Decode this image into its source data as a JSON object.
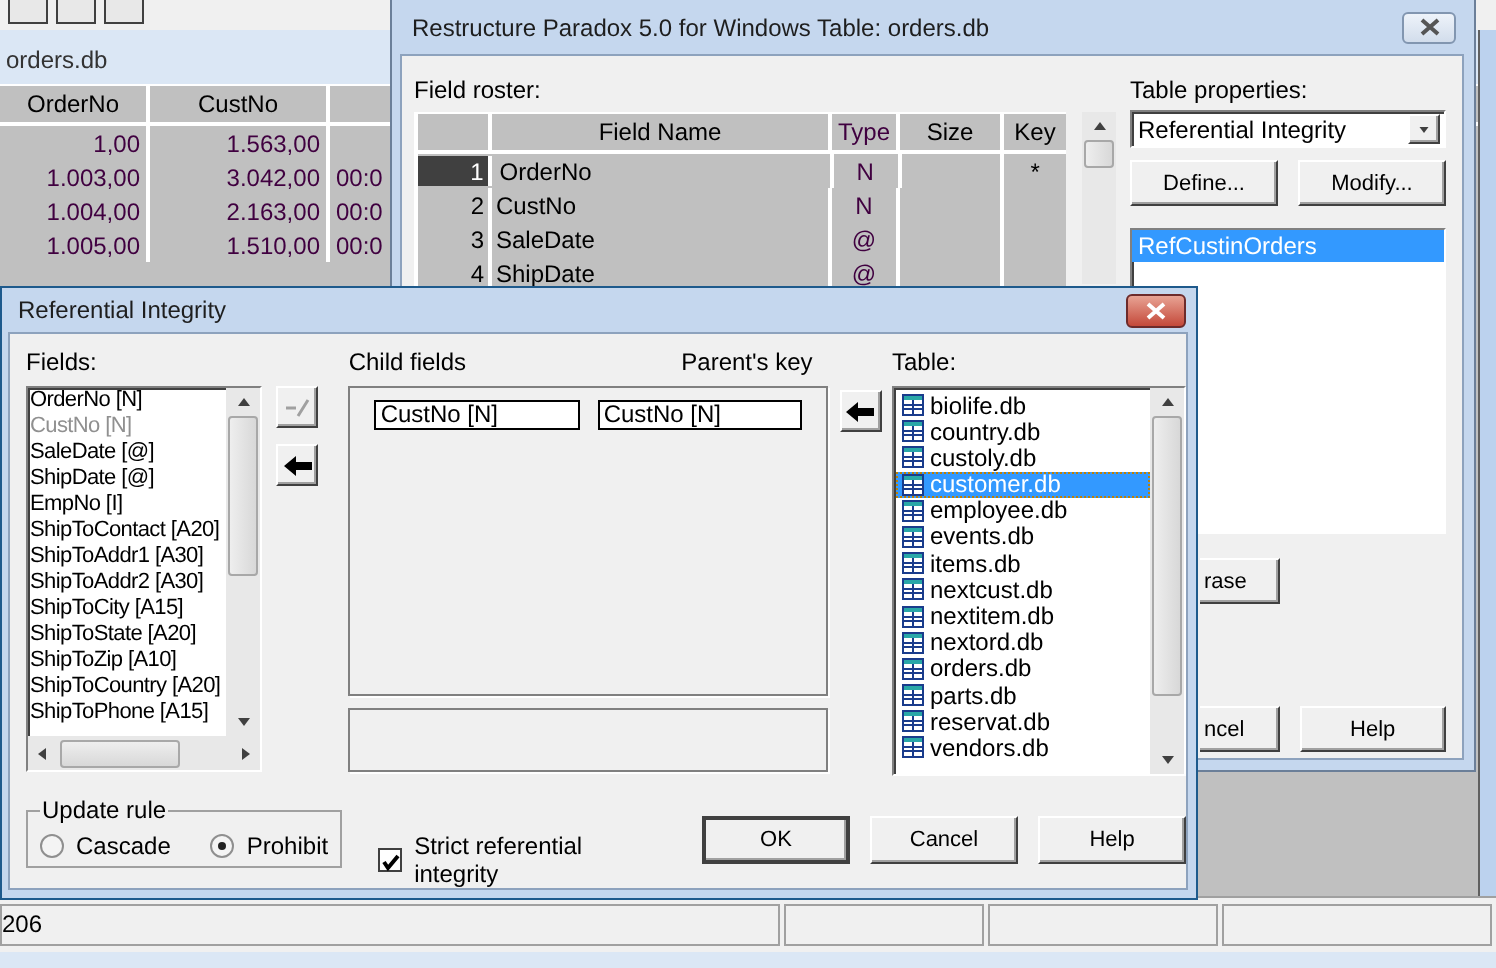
{
  "main_window": {
    "title": "orders.db",
    "columns": [
      "OrderNo",
      "CustNo"
    ],
    "rows": [
      {
        "order_no": "1,00",
        "cust_no": "1.563,00"
      },
      {
        "order_no": "1.003,00",
        "cust_no": "3.042,00",
        "column_3": "00:0"
      },
      {
        "order_no": "1.004,00",
        "cust_no": "2.163,00",
        "column_3": "00:0"
      },
      {
        "order_no": "1.005,00",
        "cust_no": "1.510,00",
        "column_3": "00:0"
      }
    ],
    "status_bar": [
      "206"
    ]
  },
  "restructure_window": {
    "title": "Restructure Paradox 5.0 for Windows Table: orders.db",
    "field_roster_label": "Field roster:",
    "roster_columns": [
      "Field Name",
      "Type",
      "Size",
      "Key"
    ],
    "fields": [
      {
        "number": "1",
        "name": "OrderNo",
        "type": "N",
        "key": "*",
        "selected": true
      },
      {
        "number": "2",
        "name": "CustNo",
        "type": "N",
        "selected": false
      },
      {
        "number": "3",
        "name": "SaleDate",
        "type": "@",
        "selected": false
      },
      {
        "number": "4",
        "name": "ShipDate",
        "type": "@",
        "selected": false
      }
    ],
    "table_properties_label": "Table properties:",
    "property_select": "Referential Integrity",
    "buttons": [
      "Define...",
      "Modify..."
    ],
    "properties": [
      {
        "label": "RefCustinOrders",
        "selected": true
      }
    ],
    "erase_button": "rase",
    "cancel_button": "ncel",
    "help_button": "Help"
  },
  "ri_dialog": {
    "title": "Referential Integrity",
    "fields_label": "Fields:",
    "fields": [
      {
        "label": "OrderNo [N]",
        "disabled": false
      },
      {
        "label": "CustNo [N]",
        "disabled": true
      },
      {
        "label": "SaleDate [@]",
        "disabled": false
      },
      {
        "label": "ShipDate [@]",
        "disabled": false
      },
      {
        "label": "EmpNo [I]",
        "disabled": false
      },
      {
        "label": "ShipToContact [A20]",
        "disabled": false
      },
      {
        "label": "ShipToAddr1 [A30]",
        "disabled": false
      },
      {
        "label": "ShipToAddr2 [A30]",
        "disabled": false
      },
      {
        "label": "ShipToCity [A15]",
        "disabled": false
      },
      {
        "label": "ShipToState [A20]",
        "disabled": false
      },
      {
        "label": "ShipToZip [A10]",
        "disabled": false
      },
      {
        "label": "ShipToCountry [A20]",
        "disabled": false
      },
      {
        "label": "ShipToPhone [A15]",
        "disabled": false
      }
    ],
    "side_buttons": [
      {
        "kind": "remove",
        "disabled": true
      },
      {
        "kind": "add",
        "disabled": false
      }
    ],
    "child_fields_label": "Child fields",
    "parents_key_label": "Parent's key",
    "child_field": "CustNo [N]",
    "parent_key": "CustNo [N]",
    "table_label": "Table:",
    "tables": [
      {
        "label": "biolife.db",
        "selected": false
      },
      {
        "label": "country.db",
        "selected": false
      },
      {
        "label": "custoly.db",
        "selected": false
      },
      {
        "label": "customer.db",
        "selected": true
      },
      {
        "label": "employee.db",
        "selected": false
      },
      {
        "label": "events.db",
        "selected": false
      },
      {
        "label": "items.db",
        "selected": false
      },
      {
        "label": "nextcust.db",
        "selected": false
      },
      {
        "label": "nextitem.db",
        "selected": false
      },
      {
        "label": "nextord.db",
        "selected": false
      },
      {
        "label": "orders.db",
        "selected": false
      },
      {
        "label": "parts.db",
        "selected": false
      },
      {
        "label": "reservat.db",
        "selected": false
      },
      {
        "label": "vendors.db",
        "selected": false
      }
    ],
    "update_rule": {
      "label": "Update rule",
      "options": [
        {
          "label": "Cascade",
          "selected": false
        },
        {
          "label": "Prohibit",
          "selected": true
        }
      ]
    },
    "strict": {
      "label": "Strict referential integrity",
      "checked": true
    },
    "buttons": [
      {
        "label": "OK",
        "default": true
      },
      {
        "label": "Cancel",
        "default": false
      },
      {
        "label": "Help",
        "default": false
      }
    ]
  }
}
